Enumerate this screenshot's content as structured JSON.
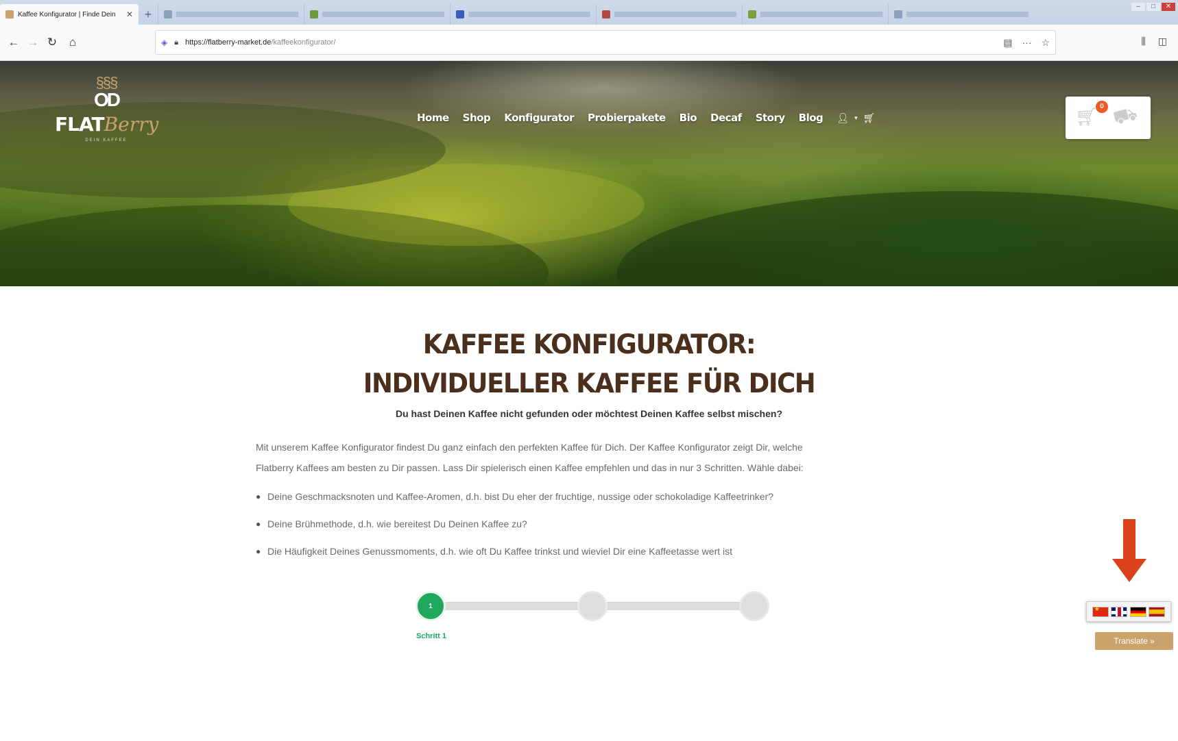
{
  "browser": {
    "active_tab_title": "Kaffee Konfigurator | Finde Dein",
    "inactive_tab_count": 6,
    "url_host": "https://flatberry-market.de",
    "url_path": "/kaffeekonfigurator/",
    "icons": {
      "back": "arrow-left-icon",
      "forward": "arrow-right-icon",
      "reload": "reload-icon",
      "home": "home-icon",
      "shield": "shield-icon",
      "lock": "lock-icon",
      "reader": "reader-view-icon",
      "more": "more-icon",
      "bookmark": "star-icon",
      "library": "library-icon",
      "sidebar": "sidebar-icon"
    }
  },
  "site": {
    "logo": {
      "brand_part1": "FLAT",
      "brand_part2": "Berry",
      "tagline": "DEIN KAFFEE"
    },
    "nav": [
      "Home",
      "Shop",
      "Konfigurator",
      "Probierpakete",
      "Bio",
      "Decaf",
      "Story",
      "Blog"
    ],
    "cart_count": "0",
    "colors": {
      "brand_brown": "#4a2f1d",
      "brand_gold": "#c9a36b",
      "step_green": "#1fa75e",
      "badge_orange": "#ee5a24",
      "arrow_red": "#d9421a"
    }
  },
  "content": {
    "title_line1": "KAFFEE KONFIGURATOR:",
    "title_line2": "INDIVIDUELLER KAFFEE FÜR DICH",
    "subtitle": "Du hast Deinen Kaffee nicht gefunden oder möchtest Deinen Kaffee selbst mischen?",
    "intro_line1": "Mit unserem Kaffee Konfigurator findest Du ganz einfach den perfekten Kaffee für Dich. Der  Kaffee Konfigurator zeigt Dir, welche",
    "intro_line2": "Flatberry Kaffees am besten zu Dir passen. Lass Dir spielerisch einen Kaffee empfehlen und das in nur 3 Schritten. Wähle dabei:",
    "bullets": [
      "Deine Geschmacksnoten und Kaffee-Aromen, d.h. bist Du eher der fruchtige, nussige oder schokoladige Kaffeetrinker?",
      "Deine Brühmethode, d.h. wie bereitest Du Deinen Kaffee zu?",
      "Die Häufigkeit Deines Genussmoments, d.h. wie oft Du Kaffee trinkst und wieviel Dir eine Kaffeetasse wert ist"
    ]
  },
  "stepper": {
    "current_step": "1",
    "total_steps": 3,
    "current_label": "Schritt 1"
  },
  "translate": {
    "button_label": "Translate »",
    "flags": [
      "chinese-flag-icon",
      "uk-flag-icon",
      "german-flag-icon",
      "spanish-flag-icon"
    ]
  }
}
